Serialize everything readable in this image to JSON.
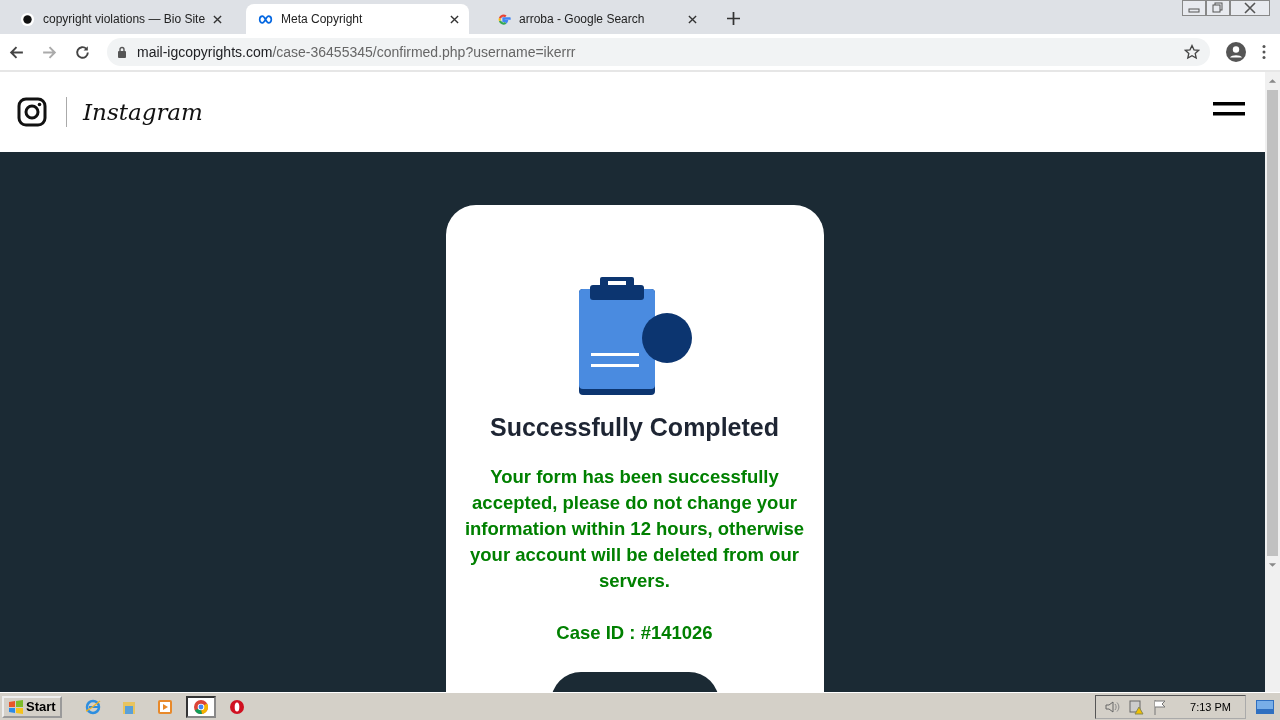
{
  "browser": {
    "tabs": [
      {
        "title": "copyright violations — Bio Site",
        "kind": "dot",
        "selected": false
      },
      {
        "title": "Meta Copyright",
        "kind": "meta",
        "selected": true
      },
      {
        "title": "arroba - Google Search",
        "kind": "google",
        "selected": false
      }
    ],
    "address": {
      "host": "mail-igcopyrights.com",
      "path": "/case-36455345/confirmed.php?username=ikerrr"
    }
  },
  "header": {
    "brand": "Instagram"
  },
  "card": {
    "title": "Successfully Completed",
    "message": "Your form has been successfully accepted, please do not change your information within 12 hours, otherwise your account will be deleted from our servers.",
    "case_id": "Case ID : #141026"
  },
  "taskbar": {
    "start": "Start",
    "apps": [
      {
        "kind": "ie",
        "selected": false
      },
      {
        "kind": "folder",
        "selected": false
      },
      {
        "kind": "media",
        "selected": false
      },
      {
        "kind": "chrome",
        "selected": true
      },
      {
        "kind": "opera",
        "selected": false
      }
    ],
    "clock": "7:13 PM"
  }
}
